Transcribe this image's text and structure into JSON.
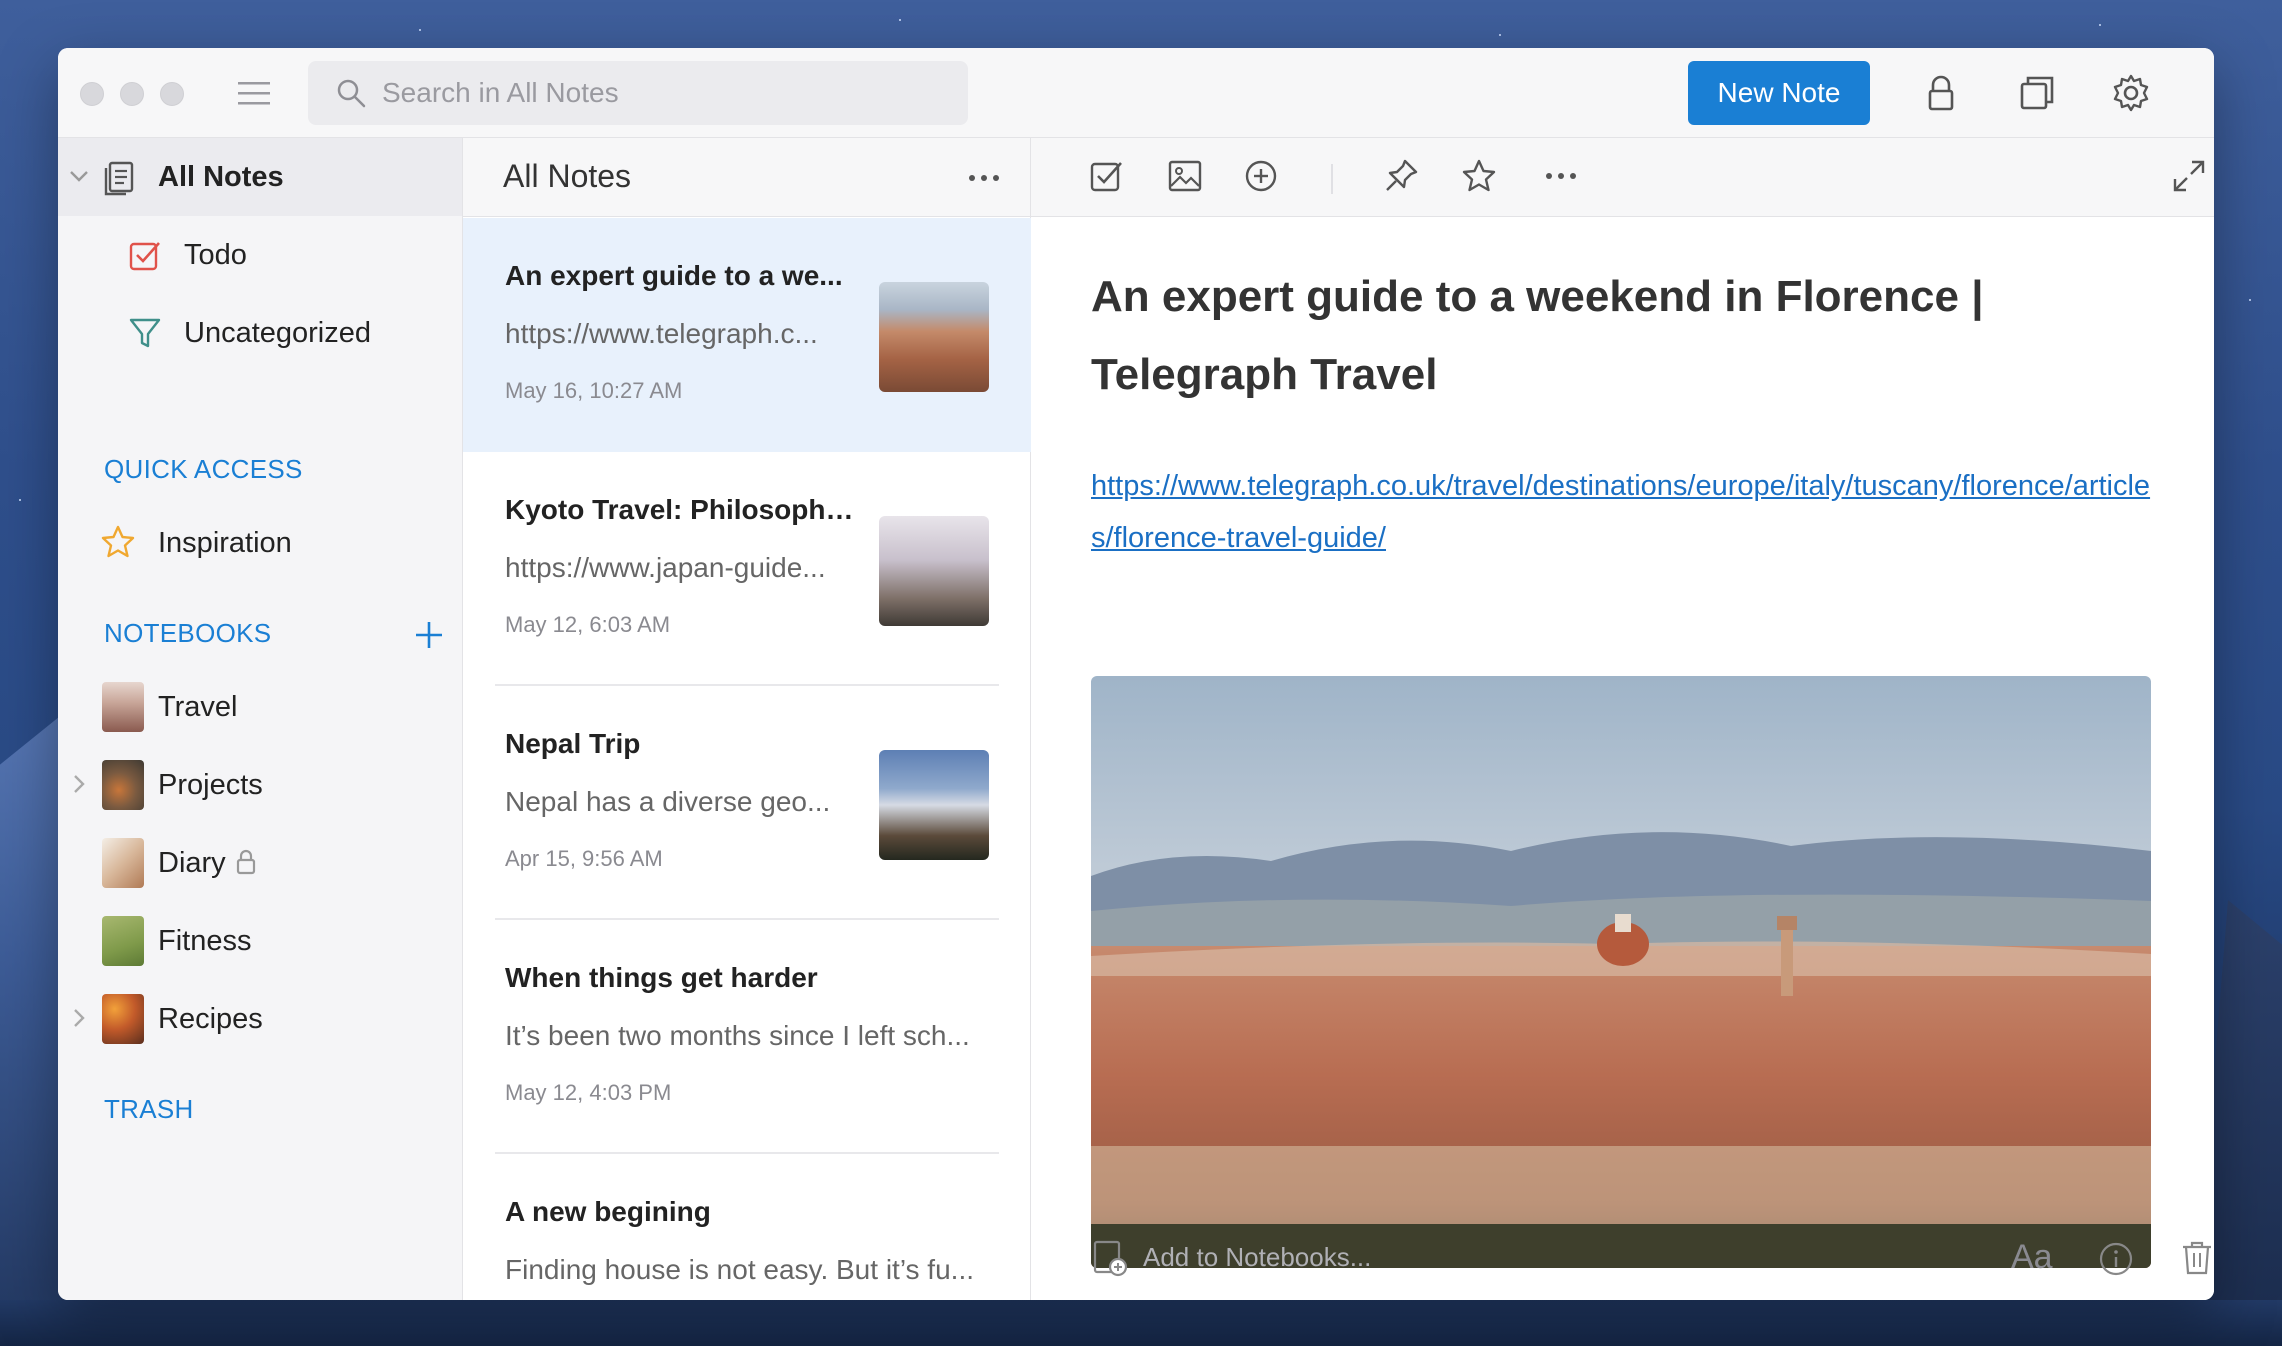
{
  "window": {
    "search_placeholder": "Search in All Notes",
    "new_note_label": "New Note",
    "accent": "#1a7fd4"
  },
  "sidebar": {
    "all_notes": "All Notes",
    "todo": "Todo",
    "uncategorized": "Uncategorized",
    "quick_access_header": "QUICK ACCESS",
    "quick_access": [
      {
        "label": "Inspiration",
        "icon": "star-icon"
      }
    ],
    "notebooks_header": "NOTEBOOKS",
    "notebooks": [
      {
        "label": "Travel",
        "has_children": false,
        "locked": false
      },
      {
        "label": "Projects",
        "has_children": true,
        "locked": false
      },
      {
        "label": "Diary",
        "has_children": false,
        "locked": true
      },
      {
        "label": "Fitness",
        "has_children": false,
        "locked": false
      },
      {
        "label": "Recipes",
        "has_children": true,
        "locked": false
      }
    ],
    "trash_header": "TRASH"
  },
  "notelist": {
    "title": "All Notes",
    "notes": [
      {
        "title": "An expert guide to a we...",
        "preview": "https://www.telegraph.c...",
        "date": "May 16, 10:27 AM",
        "has_thumb": true
      },
      {
        "title": "Kyoto Travel: Philosophe...",
        "preview": "https://www.japan-guide...",
        "date": "May 12, 6:03 AM",
        "has_thumb": true
      },
      {
        "title": "Nepal Trip",
        "preview": "Nepal has a diverse geo...",
        "date": "Apr 15, 9:56 AM",
        "has_thumb": true
      },
      {
        "title": "When things get harder",
        "preview": "It’s been two months since I left sch...",
        "date": "May 12, 4:03 PM",
        "has_thumb": false
      },
      {
        "title": "A new begining",
        "preview": "Finding house is not easy. But it’s fu...",
        "date": "",
        "has_thumb": false
      }
    ]
  },
  "editor": {
    "title": "An expert guide to a weekend in Florence | Telegraph Travel",
    "link": "https://www.telegraph.co.uk/travel/destinations/europe/italy/tuscany/florence/articles/florence-travel-guide/",
    "add_notebooks_placeholder": "Add to Notebooks...",
    "font_label": "Aa"
  }
}
